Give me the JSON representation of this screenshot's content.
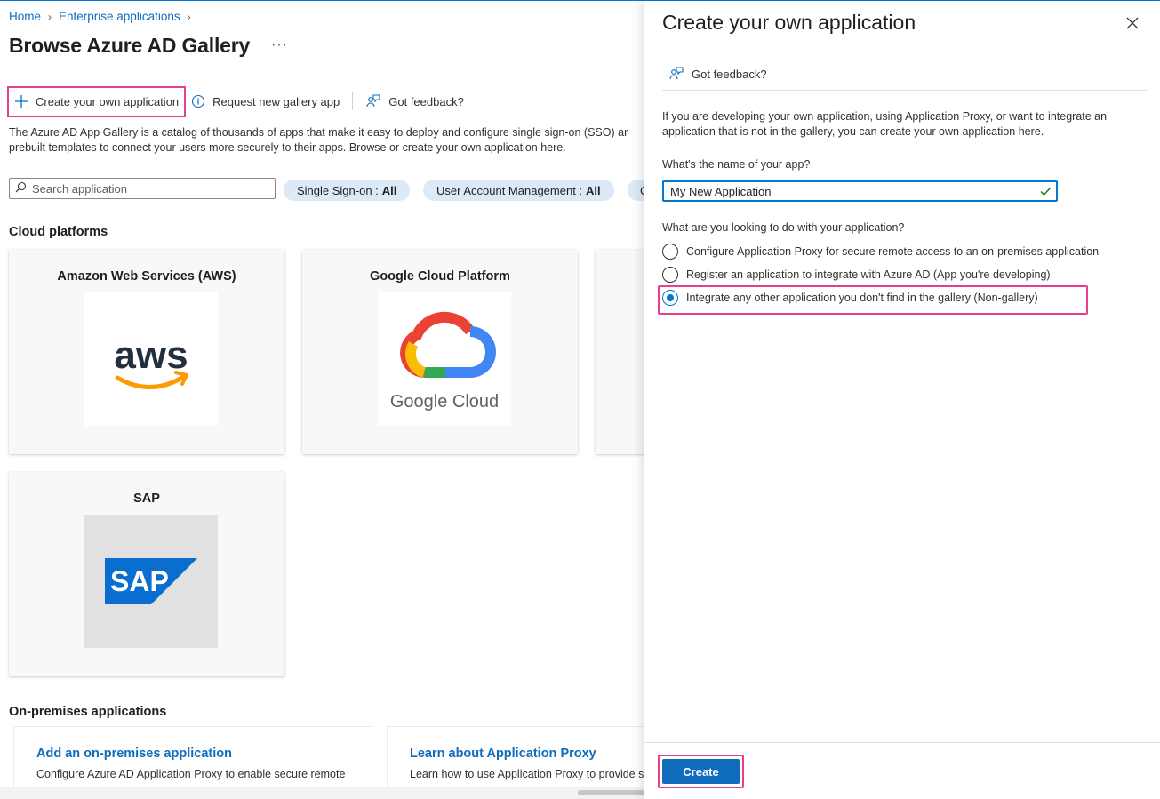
{
  "breadcrumb": {
    "home": "Home",
    "enterprise_apps": "Enterprise applications"
  },
  "page": {
    "title": "Browse Azure AD Gallery",
    "more": "···"
  },
  "toolbar": {
    "create_label": "Create your own application",
    "request_label": "Request new gallery app",
    "feedback_label": "Got feedback?"
  },
  "description": {
    "line1": "The Azure AD App Gallery is a catalog of thousands of apps that make it easy to deploy and configure single sign-on (SSO) ar",
    "line2": "prebuilt templates to connect your users more securely to their apps. Browse or create your own application here."
  },
  "search": {
    "placeholder": "Search application"
  },
  "filters": [
    {
      "label": "Single Sign-on :",
      "value": "All"
    },
    {
      "label": "User Account Management :",
      "value": "All"
    },
    {
      "label": "C",
      "value": ""
    }
  ],
  "sections": {
    "cloud": "Cloud platforms",
    "onprem": "On-premises applications"
  },
  "cloud_cards": [
    {
      "title": "Amazon Web Services (AWS)",
      "logo_text": "aws"
    },
    {
      "title": "Google Cloud Platform",
      "logo_text": "Google Cloud"
    },
    {
      "title": "SAP",
      "logo_text": "SAP"
    }
  ],
  "onprem_cards": [
    {
      "title": "Add an on-premises application",
      "text": "Configure Azure AD Application Proxy to enable secure remote"
    },
    {
      "title": "Learn about Application Proxy",
      "text": "Learn how to use Application Proxy to provide se"
    }
  ],
  "panel": {
    "title": "Create your own application",
    "feedback": "Got feedback?",
    "description": "If you are developing your own application, using Application Proxy, or want to integrate an application that is not in the gallery, you can create your own application here.",
    "name_label": "What's the name of your app?",
    "name_value": "My New Application",
    "options_label": "What are you looking to do with your application?",
    "options": [
      {
        "label": "Configure Application Proxy for secure remote access to an on-premises application",
        "checked": false
      },
      {
        "label": "Register an application to integrate with Azure AD (App you're developing)",
        "checked": false
      },
      {
        "label": "Integrate any other application you don't find in the gallery (Non-gallery)",
        "checked": true
      }
    ],
    "create_label": "Create"
  },
  "colors": {
    "accent": "#0f6cbd",
    "highlight": "#e83e8c",
    "pill_bg": "#dceaf7"
  }
}
